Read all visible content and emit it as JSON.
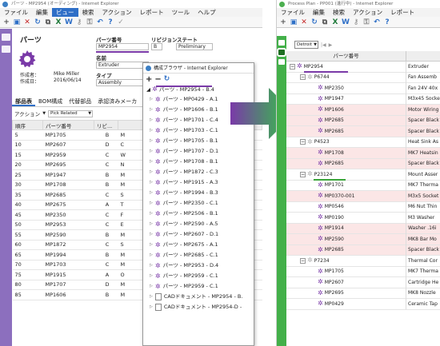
{
  "left_window": {
    "title": "パーツ - MP2954 (オーディング) - Internet Explorer",
    "menu": [
      "ファイル",
      "編集",
      "ビュー",
      "検索",
      "アクション",
      "レポート",
      "ツール",
      "ヘルプ"
    ],
    "active_menu_index": 2,
    "part_heading": "パーツ",
    "fields": {
      "part_number_label": "パーツ番号",
      "part_number_value": "MP2954",
      "revision_label": "リビジョン",
      "revision_value": "B",
      "state_label": "ステート",
      "state_value": "Preliminary",
      "name_label": "名前",
      "name_value": "Extruder",
      "type_label": "タイプ",
      "type_value": "Assembly"
    },
    "creator_label": "作成者：",
    "creator_value": "Mike Miller",
    "created_label": "作成日：",
    "created_value": "2016/06/14",
    "subtabs": [
      "部品表",
      "BOM構成",
      "代替部品",
      "承認済みメーカ"
    ],
    "active_subtab_index": 0,
    "action_label": "アクション",
    "pick_related": "Pick Related",
    "table_headers": [
      "順序",
      "パーツ番号",
      "リビ..."
    ],
    "rows": [
      [
        "5",
        "MP1705",
        "B"
      ],
      [
        "10",
        "MP2607",
        "D"
      ],
      [
        "15",
        "MP2959",
        "C"
      ],
      [
        "20",
        "MP2695",
        "C"
      ],
      [
        "25",
        "MP1947",
        "B"
      ],
      [
        "30",
        "MP1708",
        "B"
      ],
      [
        "35",
        "MP2685",
        "C"
      ],
      [
        "40",
        "MP2675",
        "A"
      ],
      [
        "45",
        "MP2350",
        "C"
      ],
      [
        "50",
        "MP2953",
        "C"
      ],
      [
        "55",
        "MP2590",
        "B"
      ],
      [
        "60",
        "MP1872",
        "C"
      ],
      [
        "65",
        "MP1994",
        "B"
      ],
      [
        "70",
        "MP1703",
        "C"
      ],
      [
        "75",
        "MP1915",
        "A"
      ],
      [
        "80",
        "MP1707",
        "D"
      ],
      [
        "85",
        "MP1606",
        "B"
      ]
    ],
    "row_tail_letters": [
      "M",
      "C",
      "W",
      "N",
      "M",
      "M",
      "S",
      "T",
      "F",
      "E",
      "M",
      "S",
      "M",
      "M",
      "O",
      "M",
      "M"
    ]
  },
  "popup": {
    "title": "構成ブラウザ - Internet Explorer",
    "root": "パーツ - MP2954 - B.4",
    "items": [
      "パーツ - MP0429 - A.1",
      "パーツ - MP1606 - B.1",
      "パーツ - MP1701 - C.4",
      "パーツ - MP1703 - C.1",
      "パーツ - MP1705 - B.1",
      "パーツ - MP1707 - D.1",
      "パーツ - MP1708 - B.1",
      "パーツ - MP1872 - C.3",
      "パーツ - MP1915 - A.3",
      "パーツ - MP1994 - B.3",
      "パーツ - MP2350 - C.1",
      "パーツ - MP2506 - B.1",
      "パーツ - MP2590 - A.5",
      "パーツ - MP2607 - D.1",
      "パーツ - MP2675 - A.1",
      "パーツ - MP2685 - C.1",
      "パーツ - MP2953 - D.4",
      "パーツ - MP2959 - C.1",
      "パーツ - MP2959 - C.1"
    ],
    "cad_items": [
      "CADドキュメント - MP2954 - B.",
      "CADドキュメント - MP2954-D -"
    ]
  },
  "right_window": {
    "title": "Process Plan - PP001 (進行中) - Internet Explorer",
    "menu": [
      "ファイル",
      "編集",
      "検索",
      "アクション",
      "レポート"
    ],
    "dropdown_value": "Detroit",
    "header_part": "パーツ番号",
    "rows": [
      {
        "id": "MP2954",
        "desc": "Extruder",
        "level": 0,
        "exp": "−",
        "pink": false
      },
      {
        "id": "P6744",
        "desc": "Fan Assemb",
        "level": 1,
        "exp": "−",
        "pink": false
      },
      {
        "id": "MP2350",
        "desc": "Fan 24V 40x",
        "level": 2,
        "exp": "",
        "pink": false
      },
      {
        "id": "MP1947",
        "desc": "M3x45 Socke",
        "level": 2,
        "exp": "",
        "pink": false
      },
      {
        "id": "MP1606",
        "desc": "Motor Wiring",
        "level": 2,
        "exp": "",
        "pink": true
      },
      {
        "id": "MP2685",
        "desc": "Spacer Black",
        "level": 2,
        "exp": "",
        "pink": true
      },
      {
        "id": "MP2685",
        "desc": "Spacer Black",
        "level": 2,
        "exp": "",
        "pink": true
      },
      {
        "id": "P4523",
        "desc": "Heat Sink As",
        "level": 1,
        "exp": "−",
        "pink": false
      },
      {
        "id": "MP1708",
        "desc": "MK7 Heatsin",
        "level": 2,
        "exp": "",
        "pink": true
      },
      {
        "id": "MP2685",
        "desc": "Spacer Black",
        "level": 2,
        "exp": "",
        "pink": true
      },
      {
        "id": "P23124",
        "desc": "Mount Asser",
        "level": 1,
        "exp": "−",
        "pink": false
      },
      {
        "id": "MP1701",
        "desc": "MK7 Therma",
        "level": 2,
        "exp": "",
        "pink": false
      },
      {
        "id": "MP0370-001",
        "desc": "M3x5 Socket",
        "level": 2,
        "exp": "",
        "pink": true
      },
      {
        "id": "MP0546",
        "desc": "M6 Nut Thin",
        "level": 2,
        "exp": "",
        "pink": false
      },
      {
        "id": "MP0190",
        "desc": "M3 Washer",
        "level": 2,
        "exp": "",
        "pink": false
      },
      {
        "id": "MP1914",
        "desc": "Washer .16i",
        "level": 2,
        "exp": "",
        "pink": true
      },
      {
        "id": "MP2590",
        "desc": "MK8 Bar Mo",
        "level": 2,
        "exp": "",
        "pink": true
      },
      {
        "id": "MP2685",
        "desc": "Spacer Black",
        "level": 2,
        "exp": "",
        "pink": true
      },
      {
        "id": "P7234",
        "desc": "Thermal Cor",
        "level": 1,
        "exp": "−",
        "pink": false
      },
      {
        "id": "MP1705",
        "desc": "MK7 Therma",
        "level": 2,
        "exp": "",
        "pink": false
      },
      {
        "id": "MP2607",
        "desc": "Cartridge He",
        "level": 2,
        "exp": "",
        "pink": false
      },
      {
        "id": "MP2695",
        "desc": "MK8 Nozzle",
        "level": 2,
        "exp": "",
        "pink": false
      },
      {
        "id": "MP0429",
        "desc": "Ceramic Tap",
        "level": 2,
        "exp": "",
        "pink": false
      }
    ]
  },
  "colors": {
    "purple_accent": "#7a3aa8",
    "left_sidebar": "#8c6fbe",
    "right_sidebar": "#43b049",
    "arrow_start": "#7a3aa8",
    "arrow_end": "#2ecc40",
    "pink_row": "#fbe6e6",
    "green_underline": "#3aa53a"
  }
}
